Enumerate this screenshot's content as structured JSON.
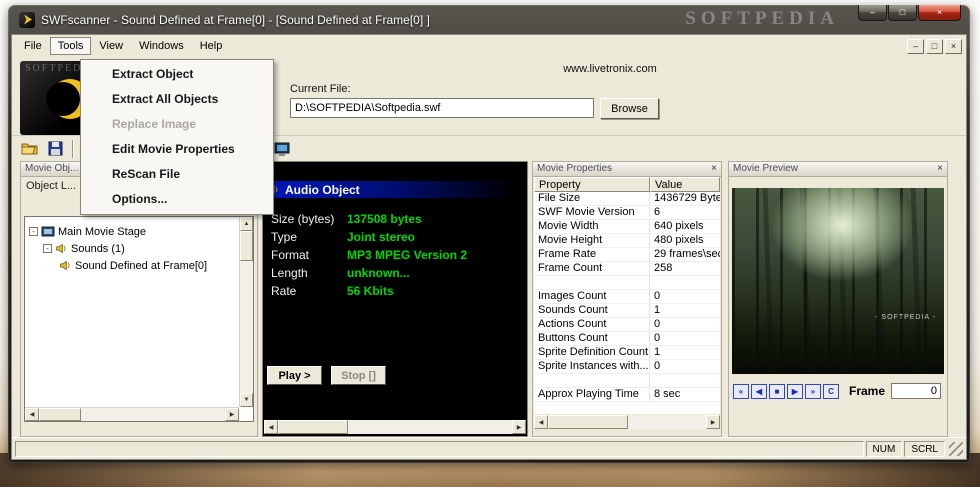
{
  "window": {
    "title": "SWFscanner - Sound Defined at Frame[0] - [Sound Defined at Frame[0] ]",
    "watermark": "SOFTPEDIA",
    "controls": {
      "minimize": "–",
      "maximize": "□",
      "close": "×"
    }
  },
  "menu": {
    "items": [
      "File",
      "Tools",
      "View",
      "Windows",
      "Help"
    ],
    "mdi": {
      "minimize": "–",
      "restore": "□",
      "close": "×"
    },
    "dropdown": {
      "items": [
        {
          "label": "Extract Object"
        },
        {
          "label": "Extract All Objects"
        },
        {
          "label": "Replace Image"
        },
        {
          "label": "Edit Movie Properties"
        },
        {
          "label": "ReScan File"
        },
        {
          "label": "Options..."
        }
      ]
    }
  },
  "header": {
    "website": "www.livetronix.com",
    "current_file_label": "Current File:",
    "current_file_value": "D:\\SOFTPEDIA\\Softpedia.swf",
    "browse_label": "Browse"
  },
  "left_panel": {
    "title": "Movie Obj...",
    "close": "×",
    "subtitle": "Object L...",
    "tree": {
      "root": "Main Movie Stage",
      "child": "Sounds (1)",
      "leaf": "Sound Defined at Frame[0]"
    }
  },
  "audio_panel": {
    "title": "Audio Object",
    "rows": [
      {
        "label": "Size (bytes)",
        "value": "137508 bytes"
      },
      {
        "label": "Type",
        "value": "Joint stereo"
      },
      {
        "label": "Format",
        "value": "MP3 MPEG Version 2"
      },
      {
        "label": "Length",
        "value": "unknown..."
      },
      {
        "label": "Rate",
        "value": "56 Kbits"
      }
    ],
    "play_label": "Play >",
    "stop_label": "Stop []"
  },
  "movie_properties": {
    "title": "Movie Properties",
    "close": "×",
    "columns": [
      "Property",
      "Value"
    ],
    "rows": [
      [
        "File Size",
        "1436729 Byte"
      ],
      [
        "SWF Movie Version",
        "6"
      ],
      [
        "Movie Width",
        "640 pixels"
      ],
      [
        "Movie Height",
        "480 pixels"
      ],
      [
        "Frame Rate",
        "29 frames\\sec"
      ],
      [
        "Frame Count",
        "258"
      ],
      [
        "",
        ""
      ],
      [
        "Images Count",
        "0"
      ],
      [
        "Sounds Count",
        "1"
      ],
      [
        "Actions Count",
        "0"
      ],
      [
        "Buttons Count",
        "0"
      ],
      [
        "Sprite Definition Count",
        "1"
      ],
      [
        "Sprite Instances with...",
        "0"
      ],
      [
        "",
        ""
      ],
      [
        "Approx Playing Time",
        "8 sec"
      ]
    ]
  },
  "movie_preview": {
    "title": "Movie Preview",
    "close": "×",
    "watermark": "- SOFTPEDIA -",
    "controls": [
      "«",
      "◀",
      "■",
      "▶",
      "»",
      "C"
    ],
    "frame_label": "Frame",
    "frame_value": "0"
  },
  "status_bar": {
    "num": "NUM",
    "scrl": "SCRL"
  }
}
